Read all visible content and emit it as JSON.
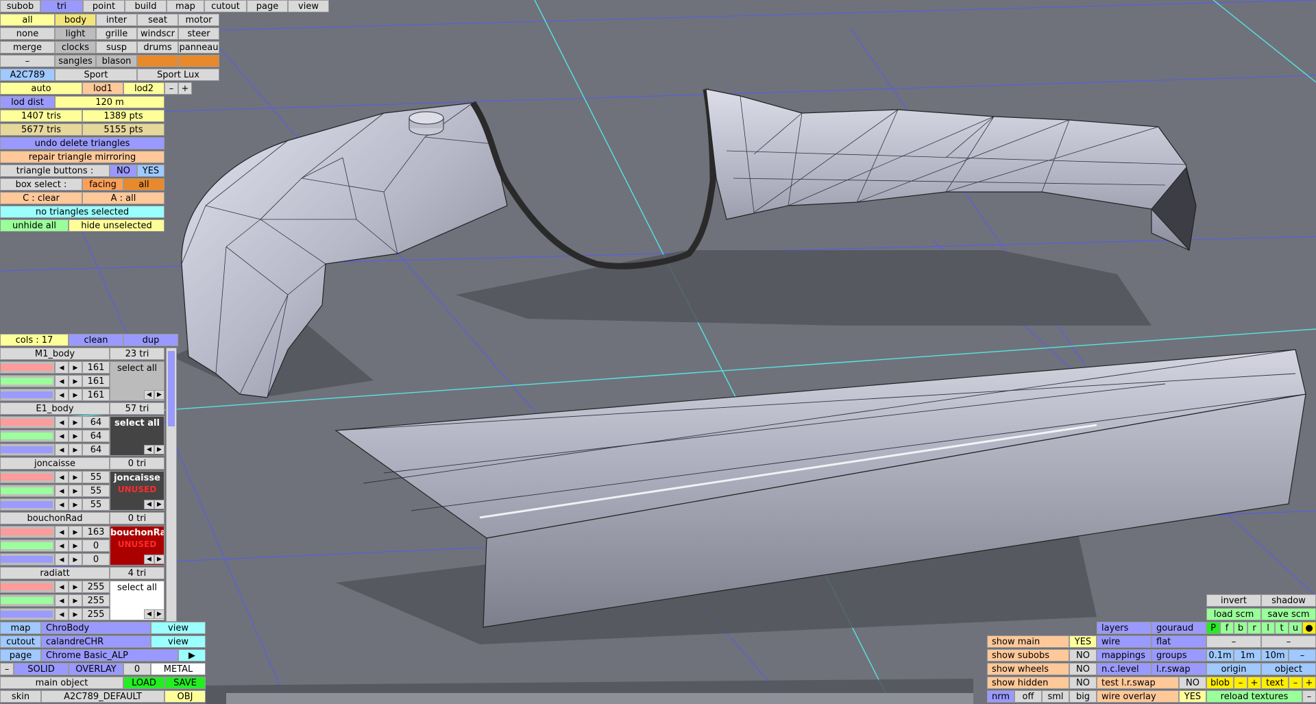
{
  "menubar": {
    "items": [
      "subob",
      "tri",
      "point",
      "build",
      "map",
      "cutout",
      "page",
      "view"
    ],
    "active_index": 1
  },
  "parts": {
    "rows": [
      [
        "all",
        "body",
        "inter",
        "seat",
        "motor"
      ],
      [
        "none",
        "light",
        "grille",
        "windscr",
        "steer"
      ],
      [
        "merge",
        "clocks",
        "susp",
        "drums",
        "panneau"
      ],
      [
        "–",
        "sangles",
        "blason",
        "",
        ""
      ]
    ]
  },
  "car": {
    "code": "A2C789",
    "variants": [
      "Sport",
      "Sport Lux"
    ]
  },
  "lod": {
    "mode": "auto",
    "lod1": "lod1",
    "lod2": "lod2",
    "minus": "–",
    "plus": "+",
    "dist_label": "lod dist",
    "dist_value": "120 m"
  },
  "stats": {
    "tris1": "1407 tris",
    "pts1": "1389 pts",
    "tris2": "5677 tris",
    "pts2": "5155 pts"
  },
  "actions": {
    "undo": "undo delete triangles",
    "repair": "repair triangle mirroring",
    "tri_buttons_label": "triangle buttons :",
    "tri_no": "NO",
    "tri_yes": "YES",
    "box_label": "box select :",
    "box_facing": "facing",
    "box_all": "all",
    "clear": "C : clear",
    "all_sel": "A : all",
    "status": "no triangles selected",
    "unhide": "unhide all",
    "hide_unsel": "hide unselected"
  },
  "cols": {
    "header": "cols : 17",
    "clean": "clean",
    "dup": "dup",
    "materials": [
      {
        "name": "M1_body",
        "tri": "23 tri",
        "rgb": [
          "161",
          "161",
          "161"
        ],
        "button": "select all",
        "swatch": "gray",
        "unused": ""
      },
      {
        "name": "E1_body",
        "tri": "57 tri",
        "rgb": [
          "64",
          "64",
          "64"
        ],
        "button": "select all",
        "swatch": "dark",
        "unused": ""
      },
      {
        "name": "joncaisse",
        "tri": "0 tri",
        "rgb": [
          "55",
          "55",
          "55"
        ],
        "button": "joncaisse",
        "swatch": "dark",
        "unused": "UNUSED"
      },
      {
        "name": "bouchonRad",
        "tri": "0 tri",
        "rgb": [
          "163",
          "0",
          "0"
        ],
        "button": "bouchonRa",
        "swatch": "red",
        "unused": "UNUSED"
      },
      {
        "name": "radiatt",
        "tri": "4 tri",
        "rgb": [
          "255",
          "255",
          "255"
        ],
        "button": "select all",
        "swatch": "white",
        "unused": ""
      }
    ]
  },
  "bottom_left": {
    "map_label": "map",
    "map_value": "ChroBody",
    "map_view": "view",
    "cutout_label": "cutout",
    "cutout_value": "calandreCHR",
    "cutout_view": "view",
    "page_label": "page",
    "page_value": "Chrome Basic_ALP",
    "page_arrow": "▶",
    "minus": "–",
    "solid": "SOLID",
    "overlay": "OVERLAY",
    "zero": "0",
    "metal": "METAL",
    "main_object": "main object",
    "load": "LOAD",
    "save": "SAVE",
    "skin_label": "skin",
    "skin_value": "A2C789_DEFAULT",
    "obj": "OBJ"
  },
  "bottom_right": {
    "show_main": "show main",
    "show_main_v": "YES",
    "show_subobs": "show subobs",
    "show_subobs_v": "NO",
    "show_wheels": "show wheels",
    "show_wheels_v": "NO",
    "show_hidden": "show hidden",
    "show_hidden_v": "NO",
    "nrm": "nrm",
    "off": "off",
    "sml": "sml",
    "big": "big",
    "layers": "layers",
    "gouraud": "gouraud",
    "wire": "wire",
    "flat": "flat",
    "mappings": "mappings",
    "groups": "groups",
    "nclevel": "n.c.level",
    "lrswap": "l.r.swap",
    "test_lrswap": "test l.r.swap",
    "test_lrswap_v": "NO",
    "wire_overlay": "wire overlay",
    "wire_overlay_v": "YES",
    "invert": "invert",
    "shadow": "shadow",
    "load_scm": "load scm",
    "save_scm": "save scm",
    "letters": [
      "P",
      "f",
      "b",
      "r",
      "l",
      "t",
      "u"
    ],
    "dot": "●",
    "dash1": "–",
    "dash2": "–",
    "s01": "0.1m",
    "s1": "1m",
    "s10": "10m",
    "sdash": "–",
    "origin": "origin",
    "object": "object",
    "blob": "blob",
    "blob_minus": "–",
    "blob_plus": "+",
    "text": "text",
    "text_minus": "–",
    "text_plus": "+",
    "reload": "reload textures",
    "reload_minus": "–"
  }
}
